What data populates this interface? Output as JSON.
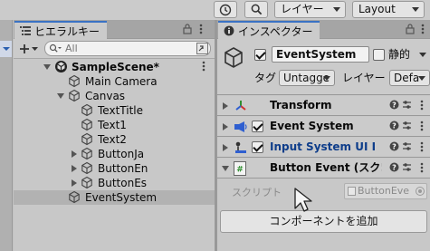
{
  "toolbar": {
    "history_icon": "history-icon",
    "search_icon": "search-icon",
    "layers_label": "レイヤー",
    "layout_label": "Layout"
  },
  "hierarchy": {
    "tab_label": "ヒエラルキー",
    "search_placeholder": "All",
    "scene_name": "SampleScene*",
    "items": [
      {
        "label": "Main Camera"
      },
      {
        "label": "Canvas"
      },
      {
        "label": "TextTitle"
      },
      {
        "label": "Text1"
      },
      {
        "label": "Text2"
      },
      {
        "label": "ButtonJa"
      },
      {
        "label": "ButtonEn"
      },
      {
        "label": "ButtonEs"
      },
      {
        "label": "EventSystem",
        "selected": true
      }
    ]
  },
  "inspector": {
    "tab_label": "インスペクター",
    "object_name": "EventSystem",
    "object_active": true,
    "static_label": "静的",
    "tag_label": "タグ",
    "tag_value": "Untagge",
    "layer_label": "レイヤー",
    "layer_value": "Defa",
    "components": [
      {
        "name": "Transform",
        "has_checkbox": false,
        "expanded": false
      },
      {
        "name": "Event System",
        "has_checkbox": true,
        "expanded": false
      },
      {
        "name": "Input System UI I",
        "has_checkbox": true,
        "expanded": false,
        "highlight": true
      },
      {
        "name": "Button Event (スク!",
        "has_checkbox": false,
        "expanded": true
      }
    ],
    "script_label": "スクリプト",
    "script_value": "ButtonEve",
    "add_component_label": "コンポーネントを追加"
  },
  "colors": {
    "selection": "#b2b2b2",
    "accent_blue": "#3a72c4",
    "highlight_text": "#0e3d8a",
    "panel_bg": "#c8c8c8"
  }
}
